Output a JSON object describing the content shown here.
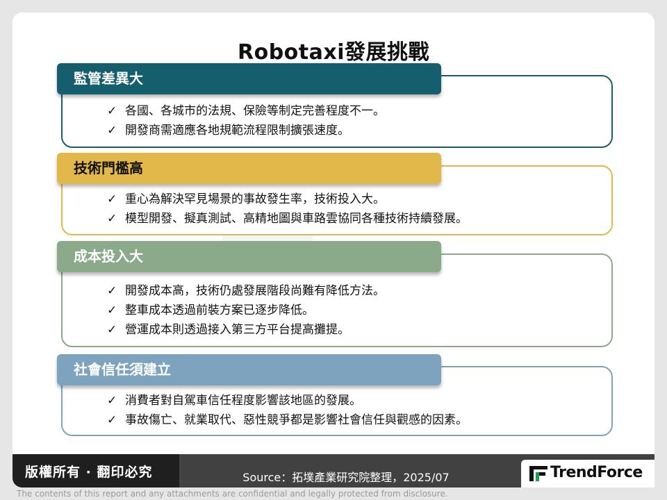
{
  "slide": {
    "title": "Robotaxi發展挑戰"
  },
  "sections": [
    {
      "heading": "監管差異大",
      "items": [
        "各國、各城市的法規、保險等制定完善程度不一。",
        "開發商需適應各地規範流程限制擴張速度。"
      ]
    },
    {
      "heading": "技術門檻高",
      "items": [
        "重心為解決罕見場景的事故發生率，技術投入大。",
        "模型開發、擬真測試、高精地圖與車路雲協同各種技術持續發展。"
      ]
    },
    {
      "heading": "成本投入大",
      "items": [
        "開發成本高，技術仍處發展階段尚難有降低方法。",
        "整車成本透過前裝方案已逐步降低。",
        "營運成本則透過接入第三方平台提高攤提。"
      ]
    },
    {
      "heading": "社會信任須建立",
      "items": [
        "消費者對自駕車信任程度影響該地區的發展。",
        "事故傷亡、就業取代、惡性競爭都是影響社會信任與觀感的因素。"
      ]
    }
  ],
  "check_mark": "✓",
  "colors": {
    "regulation": "#155e6d",
    "technology": "#e3b84a",
    "cost": "#8aaa8a",
    "trust": "#7da3bf"
  },
  "footer": {
    "copyright": "版權所有 · 翻印必究",
    "source": "Source：拓墣產業研究院整理，2025/07",
    "logo_text": "TrendForce",
    "disclaimer": "The contents of this report and any attachments are confidential and legally protected from disclosure."
  }
}
